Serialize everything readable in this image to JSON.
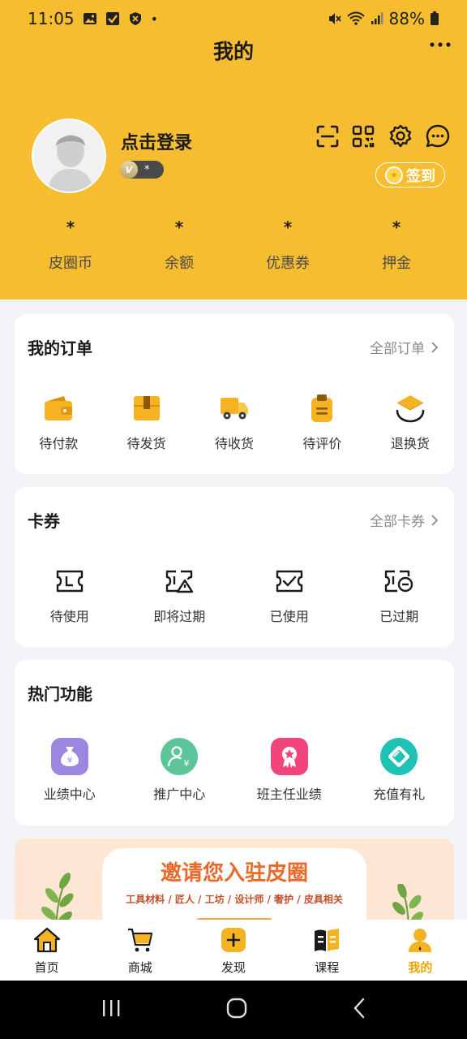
{
  "status_bar": {
    "time": "11:05",
    "dot": "•",
    "battery": "88%"
  },
  "header": {
    "title": "我的",
    "login_text": "点击登录",
    "vip_letter": "v",
    "vip_value": "*",
    "signin_label": "签到"
  },
  "stats": [
    {
      "value": "*",
      "label": "皮圈币"
    },
    {
      "value": "*",
      "label": "余额"
    },
    {
      "value": "*",
      "label": "优惠券"
    },
    {
      "value": "*",
      "label": "押金"
    }
  ],
  "orders": {
    "title": "我的订单",
    "link": "全部订单",
    "items": [
      {
        "label": "待付款",
        "icon": "wallet-icon"
      },
      {
        "label": "待发货",
        "icon": "box-icon"
      },
      {
        "label": "待收货",
        "icon": "truck-icon"
      },
      {
        "label": "待评价",
        "icon": "clipboard-icon"
      },
      {
        "label": "退换货",
        "icon": "return-box-icon"
      }
    ]
  },
  "coupons": {
    "title": "卡券",
    "link": "全部卡券",
    "items": [
      {
        "label": "待使用",
        "icon": "ticket-icon"
      },
      {
        "label": "即将过期",
        "icon": "ticket-warning-icon"
      },
      {
        "label": "已使用",
        "icon": "ticket-check-icon"
      },
      {
        "label": "已过期",
        "icon": "ticket-expired-icon"
      }
    ]
  },
  "features": {
    "title": "热门功能",
    "items": [
      {
        "label": "业绩中心",
        "icon": "money-bag-icon",
        "color": "#9b86e0"
      },
      {
        "label": "推广中心",
        "icon": "user-yen-icon",
        "color": "#5cc69a"
      },
      {
        "label": "班主任业绩",
        "icon": "award-icon",
        "color": "#f0447a"
      },
      {
        "label": "充值有礼",
        "icon": "gift-card-icon",
        "color": "#20c2b5"
      }
    ]
  },
  "banner": {
    "title": "邀请您入驻皮圈",
    "subtitle": "工具材料 / 匠人 / 工坊 / 设计师 / 奢护 / 皮具相关"
  },
  "tabs": [
    {
      "label": "首页",
      "icon": "home-icon"
    },
    {
      "label": "商城",
      "icon": "cart-icon"
    },
    {
      "label": "发现",
      "icon": "plus-icon"
    },
    {
      "label": "课程",
      "icon": "book-icon"
    },
    {
      "label": "我的",
      "icon": "profile-icon",
      "active": true
    }
  ],
  "colors": {
    "brand_yellow": "#f5bd2f",
    "accent_orange": "#f0a500"
  }
}
